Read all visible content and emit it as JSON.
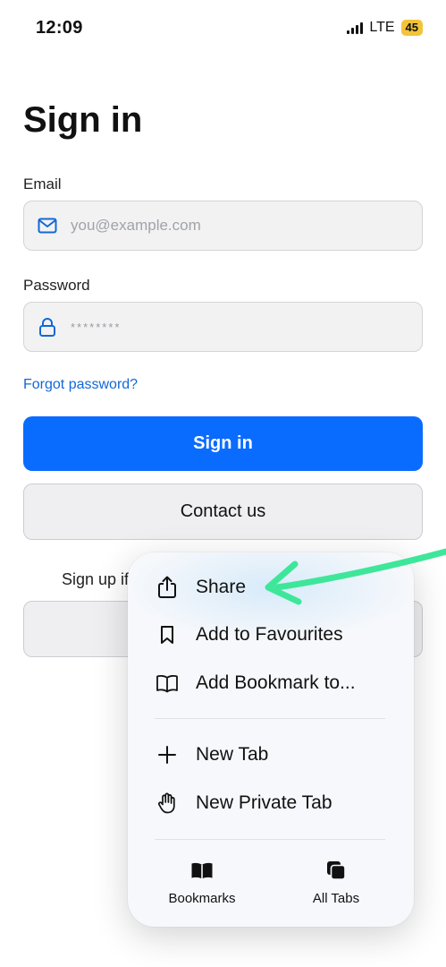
{
  "status_bar": {
    "time": "12:09",
    "network": "LTE",
    "battery": "45"
  },
  "page": {
    "title": "Sign in",
    "email": {
      "label": "Email",
      "placeholder": "you@example.com"
    },
    "password": {
      "label": "Password",
      "placeholder": "********"
    },
    "forgot_link": "Forgot password?",
    "sign_in_button": "Sign in",
    "contact_button": "Contact us",
    "signup_prompt": "Sign up if"
  },
  "context_menu": {
    "items": [
      {
        "label": "Share",
        "icon": "share-icon"
      },
      {
        "label": "Add to Favourites",
        "icon": "bookmark-icon"
      },
      {
        "label": "Add Bookmark to...",
        "icon": "book-icon"
      },
      {
        "label": "New Tab",
        "icon": "plus-icon"
      },
      {
        "label": "New Private Tab",
        "icon": "hand-icon"
      }
    ],
    "footer": [
      {
        "label": "Bookmarks",
        "icon": "bookmarks-icon"
      },
      {
        "label": "All Tabs",
        "icon": "tabs-icon"
      }
    ]
  },
  "colors": {
    "primary": "#0a6cff",
    "link": "#1268d6",
    "annotation_arrow": "#3ee69a"
  }
}
